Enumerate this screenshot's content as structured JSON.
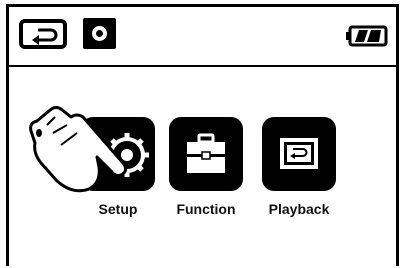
{
  "header": {
    "back_icon": "back-arrow-icon",
    "camera_icon": "camera-icon",
    "battery_icon": "battery-icon"
  },
  "menu": {
    "items": [
      {
        "label": "Setup",
        "icon": "gear-icon"
      },
      {
        "label": "Function",
        "icon": "toolbox-icon"
      },
      {
        "label": "Playback",
        "icon": "playback-icon"
      }
    ]
  },
  "overlay": {
    "icon": "pointing-hand-icon"
  }
}
